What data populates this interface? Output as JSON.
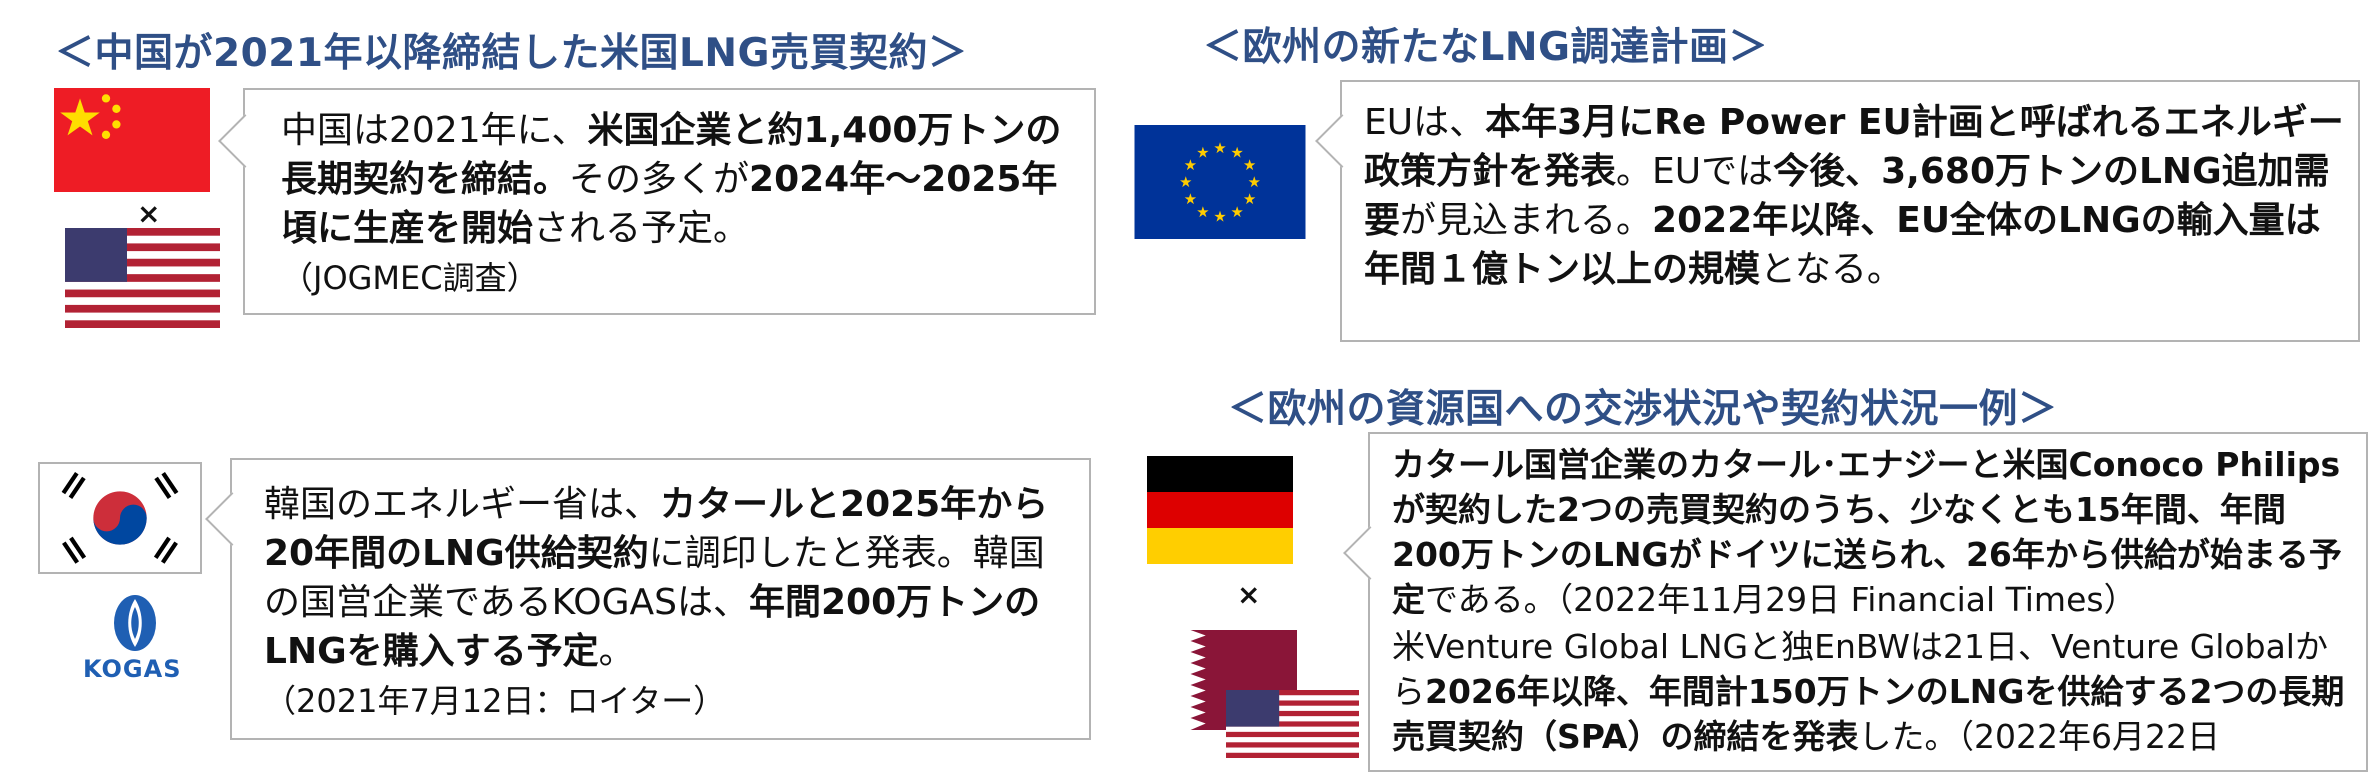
{
  "china_section": {
    "heading": "＜中国が2021年以降締結した米国LNG売買契約＞",
    "body_parts": [
      "中国は2021年に、",
      "米国企業と約1,400万トンの長期契約を締結。",
      "その多くが",
      "2024年～2025年頃に生産を開始",
      "される予定。"
    ],
    "source": "（JOGMEC調査）",
    "separator": "×"
  },
  "korea_section": {
    "body_parts": [
      "韓国のエネルギー省は、",
      "カタールと2025年から20年間のLNG供給契約",
      "に調印したと発表。韓国の国営企業であるKOGASは、",
      "年間200万トンのLNGを購入する予定",
      "。"
    ],
    "source": "（2021年7月12日：ロイター）",
    "logo_text": "KOGAS"
  },
  "eu_section": {
    "heading": "＜欧州の新たなLNG調達計画＞",
    "body_parts": [
      "EUは、",
      "本年3月にRe Power EU計画と呼ばれるエネルギー政策方針を発表",
      "。EUでは",
      "今後、3,680万トンのLNG追加需要",
      "が見込まれる。",
      "2022年以降、EU全体のLNGの輸入量は年間１億トン以上の規模",
      "となる。"
    ]
  },
  "europe_deals_section": {
    "heading": "＜欧州の資源国への交渉状況や契約状況一例＞",
    "para1_bold": "カタール国営企業のカタール･エナジーと米国Conoco Philipsが契約した2つの売買契約のうち、少なくとも15年間、年間200万トンのLNGがドイツに送られ、26年から供給が始まる予定",
    "para1_rest": "である。（2022年11月29日 Financial Times）",
    "para2_start": "米Venture Global LNGと独EnBWは21日、Venture Globalから",
    "para2_bold": "2026年以降、年間計150万トンのLNGを供給する2つの長期売買契約（SPA）の締結を発表",
    "para2_rest": "した。（2022年6月22日",
    "separator": "×"
  },
  "colors": {
    "heading": "#2f4f86",
    "border": "#b3b3b3",
    "china_red": "#ee1c25",
    "china_star": "#ffde00",
    "us_red": "#b22234",
    "us_blue": "#3c3b6e",
    "eu_blue": "#003399",
    "eu_star": "#ffcc00",
    "korea_red": "#cd2e3a",
    "korea_blue": "#0047a0",
    "germany_red": "#dd0000",
    "germany_gold": "#ffce00",
    "qatar_maroon": "#8a1538",
    "kogas_blue": "#1f5fb3"
  },
  "icons": [
    "china-flag-icon",
    "us-flag-icon",
    "eu-flag-icon",
    "korea-flag-icon",
    "kogas-logo-icon",
    "germany-flag-icon",
    "qatar-flag-icon"
  ]
}
